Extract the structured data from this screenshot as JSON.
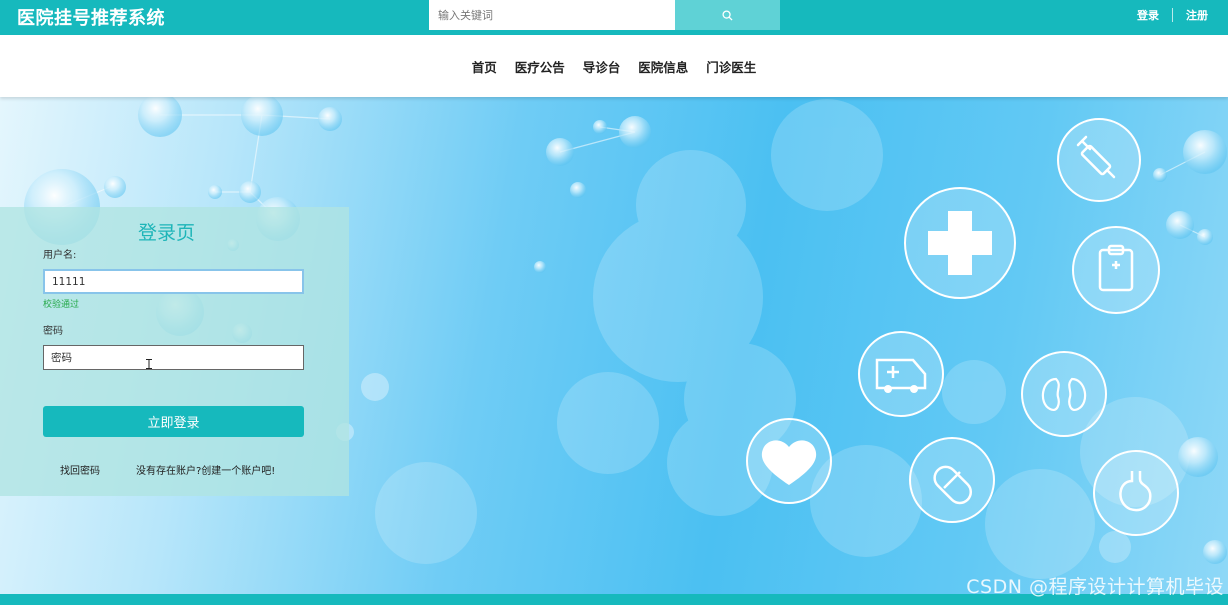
{
  "header": {
    "brand": "医院挂号推荐系统",
    "search": {
      "placeholder": "输入关键词",
      "button_icon": "search-icon"
    },
    "login": "登录",
    "register": "注册"
  },
  "nav": {
    "items": [
      {
        "label": "首页"
      },
      {
        "label": "医疗公告"
      },
      {
        "label": "导诊台"
      },
      {
        "label": "医院信息"
      },
      {
        "label": "门诊医生"
      }
    ]
  },
  "login": {
    "title": "登录页",
    "username_label": "用户名:",
    "username_value": "11111",
    "username_status": "校验通过",
    "password_label": "密码",
    "password_placeholder": "密码",
    "submit": "立即登录",
    "forgot": "找回密码",
    "signup": "没有存在账户?创建一个账户吧!"
  },
  "hero_icons": [
    "syringe-icon",
    "medical-cross-icon",
    "clipboard-icon",
    "ambulance-icon",
    "kidney-icon",
    "heart-icon",
    "pill-icon",
    "stomach-icon"
  ],
  "watermark": "CSDN @程序设计计算机毕设",
  "colors": {
    "accent": "#16b9bd",
    "search_button": "#5fd2d6",
    "valid": "#26a94a"
  }
}
